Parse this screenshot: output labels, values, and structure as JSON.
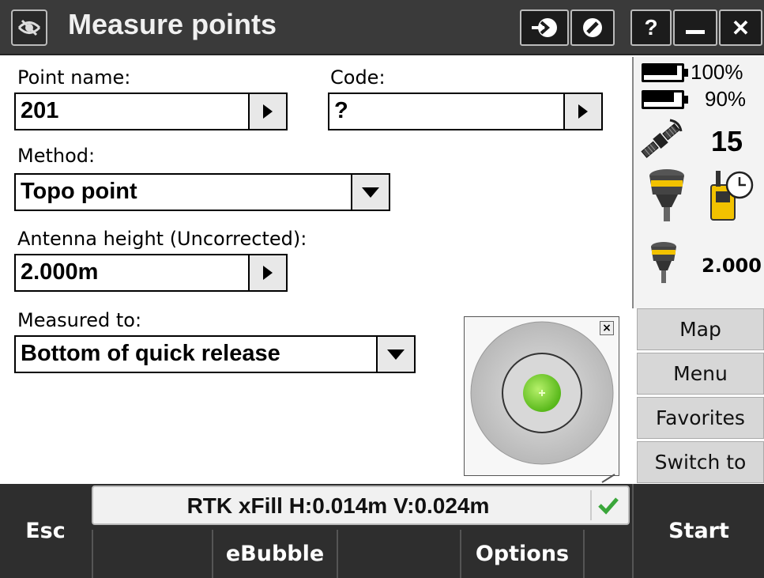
{
  "titlebar": {
    "title": "Measure points",
    "buttons": [
      "?",
      "✕"
    ]
  },
  "form": {
    "point_name": {
      "label": "Point name:",
      "value": "201"
    },
    "code": {
      "label": "Code:",
      "value": "?"
    },
    "method": {
      "label": "Method:",
      "value": "Topo point"
    },
    "antenna_height": {
      "label": "Antenna height (Uncorrected):",
      "value": "2.000m"
    },
    "measured_to": {
      "label": "Measured to:",
      "value": "Bottom of quick release"
    }
  },
  "status": {
    "battery1_pct": "100%",
    "battery1_level": 1.0,
    "battery2_pct": "90%",
    "battery2_level": 0.9,
    "satellites": "15",
    "antenna_height": "2.000"
  },
  "side_buttons": {
    "map": "Map",
    "menu": "Menu",
    "favorites": "Favorites",
    "switch_to": "Switch to"
  },
  "bottom": {
    "solution": "RTK xFill H:0.014m V:0.024m",
    "esc": "Esc",
    "ebubble": "eBubble",
    "options": "Options",
    "start": "Start"
  },
  "colors": {
    "titlebar": "#3a3a3a",
    "bubble_green": "#7ed62a",
    "check_green": "#3aa63a",
    "receiver_yellow": "#f2c200"
  }
}
